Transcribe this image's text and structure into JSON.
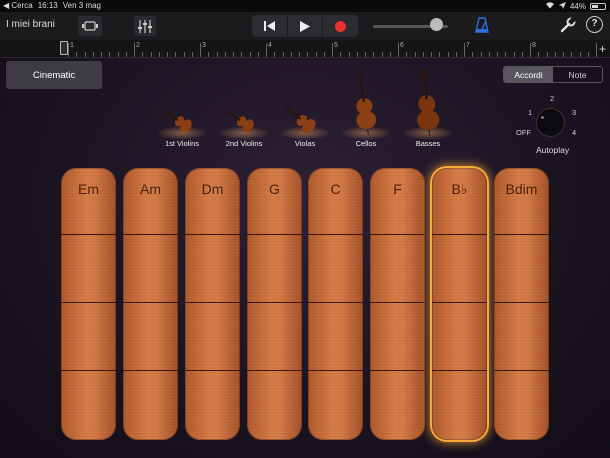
{
  "status": {
    "carrier": "◀ Cerca",
    "time": "16:13",
    "date": "Ven 3 mag",
    "battery": "44%"
  },
  "toolbar": {
    "my_songs": "I miei brani",
    "icons": [
      "view-toggle-icon",
      "mixer-icon",
      "rewind-icon",
      "play-icon",
      "record-icon",
      "metronome-icon",
      "wrench-icon",
      "help-icon"
    ],
    "help_label": "?"
  },
  "ruler": {
    "markers": [
      "1",
      "2",
      "3",
      "4",
      "5",
      "6",
      "7",
      "8"
    ],
    "plus": "+"
  },
  "main": {
    "instrument_button": "Cinematic",
    "mode_tabs": [
      {
        "label": "Accordi",
        "selected": true
      },
      {
        "label": "Note",
        "selected": false
      }
    ],
    "autoplay": {
      "label": "Autoplay",
      "off": "OFF",
      "pos1": "1",
      "pos2": "2",
      "pos3": "3",
      "pos4": "4",
      "value": "OFF"
    },
    "instruments": [
      {
        "label": "1st Violins"
      },
      {
        "label": "2nd Violins"
      },
      {
        "label": "Violas"
      },
      {
        "label": "Cellos"
      },
      {
        "label": "Basses"
      }
    ],
    "chords": [
      {
        "label": "Em",
        "selected": false
      },
      {
        "label": "Am",
        "selected": false
      },
      {
        "label": "Dm",
        "selected": false
      },
      {
        "label": "G",
        "selected": false
      },
      {
        "label": "C",
        "selected": false
      },
      {
        "label": "F",
        "selected": false
      },
      {
        "label": "B♭",
        "selected": true
      },
      {
        "label": "Bdim",
        "selected": false
      }
    ]
  },
  "colors": {
    "accent": "#f7a93a",
    "record": "#e8312f",
    "metronome": "#2f6fdc",
    "strip": "#d47945"
  }
}
